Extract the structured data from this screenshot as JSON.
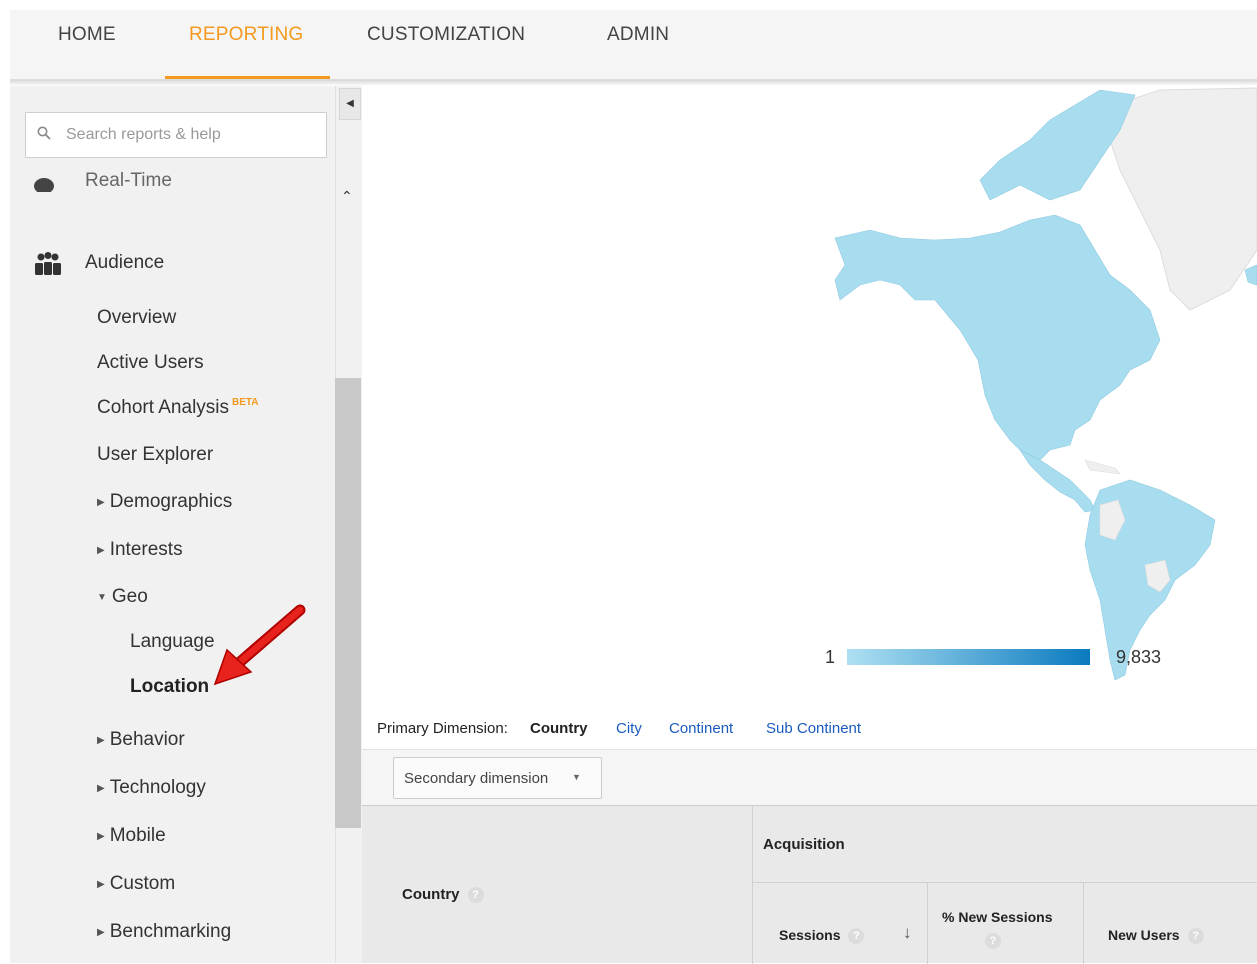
{
  "topnav": {
    "tabs": [
      {
        "label": "HOME"
      },
      {
        "label": "REPORTING"
      },
      {
        "label": "CUSTOMIZATION"
      },
      {
        "label": "ADMIN"
      }
    ],
    "active_tab": "REPORTING"
  },
  "sidebar": {
    "search_placeholder": "Search reports & help",
    "partial_item": "Real-Time",
    "section": "Audience",
    "items": [
      {
        "label": "Overview"
      },
      {
        "label": "Active Users"
      },
      {
        "label": "Cohort Analysis",
        "badge": "BETA"
      },
      {
        "label": "User Explorer"
      },
      {
        "label": "Demographics"
      },
      {
        "label": "Interests"
      },
      {
        "label": "Geo"
      },
      {
        "label": "Behavior"
      },
      {
        "label": "Technology"
      },
      {
        "label": "Mobile"
      },
      {
        "label": "Custom"
      },
      {
        "label": "Benchmarking"
      }
    ],
    "geo_children": [
      {
        "label": "Language"
      },
      {
        "label": "Location"
      }
    ],
    "selected": "Location"
  },
  "map": {
    "legend_min": "1",
    "legend_max": "9,833",
    "land_color": "#a8dcef",
    "inactive_color": "#f0f0f0"
  },
  "dimensions": {
    "label": "Primary Dimension:",
    "active": "Country",
    "links": [
      "City",
      "Continent",
      "Sub Continent"
    ],
    "secondary": "Secondary dimension"
  },
  "table": {
    "country_header": "Country",
    "group_header": "Acquisition",
    "sessions": "Sessions",
    "pct_new_sessions": "% New Sessions",
    "new_users": "New Users"
  }
}
